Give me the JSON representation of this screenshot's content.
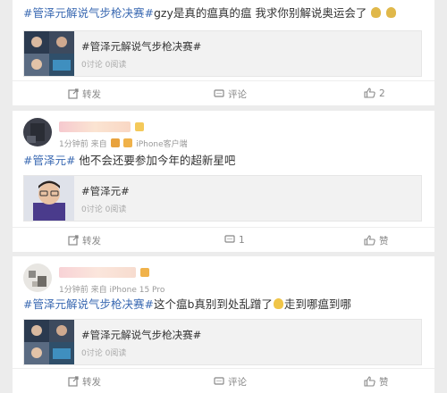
{
  "posts": [
    {
      "text_topic": "#管泽元解说气步枪决赛#",
      "text_body": "gzy是真的瘟真的瘟 我求你别解说奥运会了",
      "share": {
        "title": "#管泽元解说气步枪决赛#",
        "stats": "0讨论 0阅读"
      },
      "actions": {
        "repost": "转发",
        "comment": "评论",
        "like": "2"
      }
    },
    {
      "meta": {
        "time": "1分钟前",
        "from": "来自",
        "client": "iPhone客户端"
      },
      "text_topic": "#管泽元#",
      "text_body": " 他不会还要参加今年的超新星吧",
      "share": {
        "title": "#管泽元#",
        "stats": "0讨论 0阅读"
      },
      "actions": {
        "repost": "转发",
        "comment": "1",
        "like": "赞"
      }
    },
    {
      "meta": {
        "time": "1分钟前",
        "from": "来自",
        "client": "iPhone 15 Pro"
      },
      "text_topic": "#管泽元解说气步枪决赛#",
      "text_body_a": "这个瘟b真别到处乱蹭了",
      "text_body_b": "走到哪瘟到哪",
      "share": {
        "title": "#管泽元解说气步枪决赛#",
        "stats": "0讨论 0阅读"
      },
      "actions": {
        "repost": "转发",
        "comment": "评论",
        "like": "赞"
      }
    }
  ],
  "colors": {
    "topic": "#3a69b2",
    "page_bg": "#ececec",
    "card_bg": "#ffffff",
    "action_gray": "#888888"
  },
  "icons": {
    "repost": "repost-icon",
    "comment": "comment-icon",
    "like": "thumbs-up-icon",
    "emoji_trophy": "trophy-emoji",
    "emoji_smirk": "smirk-emoji"
  }
}
